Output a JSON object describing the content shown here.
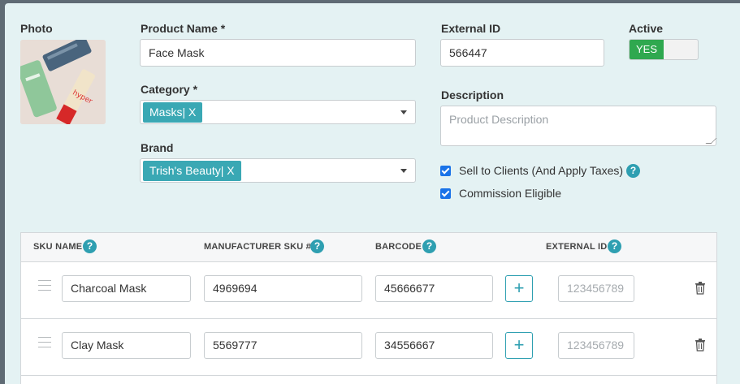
{
  "form": {
    "photo_label": "Photo",
    "product_name_label": "Product Name *",
    "product_name_value": "Face Mask",
    "category_label": "Category *",
    "category_tag": "Masks| X",
    "brand_label": "Brand",
    "brand_tag": "Trish's Beauty| X",
    "external_id_label": "External ID",
    "external_id_value": "566447",
    "active_label": "Active",
    "active_toggle": "YES",
    "description_label": "Description",
    "description_placeholder": "Product Description",
    "sell_to_clients_label": "Sell to Clients (And Apply Taxes)",
    "commission_label": "Commission Eligible",
    "help_glyph": "?"
  },
  "sku_table": {
    "headers": {
      "sku_name": "SKU NAME",
      "manufacturer_sku": "MANUFACTURER SKU #",
      "barcode": "BARCODE",
      "external_id": "EXTERNAL ID"
    },
    "rows": [
      {
        "sku_name": "Charcoal Mask",
        "manufacturer_sku": "4969694",
        "barcode": "45666677",
        "external_id_placeholder": "123456789"
      },
      {
        "sku_name": "Clay Mask",
        "manufacturer_sku": "5569777",
        "barcode": "34556667",
        "external_id_placeholder": "123456789"
      }
    ],
    "add_glyph": "+"
  },
  "colors": {
    "modal_bg": "#e4f2f3",
    "tag": "#3aa8b4",
    "toggle_on": "#2fa84f",
    "help_icon": "#2e9fb1",
    "checkbox": "#1a73e8"
  }
}
